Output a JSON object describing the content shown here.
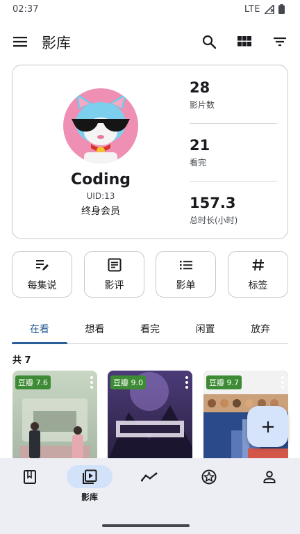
{
  "status_bar": {
    "time": "02:37",
    "network": "LTE"
  },
  "app_bar": {
    "title": "影库",
    "icons": [
      "menu-icon",
      "search-icon",
      "grid-view-icon",
      "filter-icon"
    ]
  },
  "profile": {
    "nickname": "Coding",
    "uid": "UID:13",
    "membership": "终身会员",
    "stats": [
      {
        "value": "28",
        "label": "影片数"
      },
      {
        "value": "21",
        "label": "看完"
      },
      {
        "value": "157.3",
        "label": "总时长(小时)"
      }
    ]
  },
  "quick_actions": [
    {
      "label": "每集说",
      "icon": "edit-note-icon"
    },
    {
      "label": "影评",
      "icon": "article-icon"
    },
    {
      "label": "影单",
      "icon": "list-icon"
    },
    {
      "label": "标签",
      "icon": "tag-icon"
    }
  ],
  "tabs": [
    {
      "label": "在看",
      "active": true
    },
    {
      "label": "想看"
    },
    {
      "label": "看完"
    },
    {
      "label": "闲置"
    },
    {
      "label": "放弃"
    }
  ],
  "total_count": "共 7",
  "posters": [
    {
      "rating": "豆瓣 7.6"
    },
    {
      "rating": "豆瓣 9.0"
    },
    {
      "rating": "豆瓣 9.7"
    }
  ],
  "bottom_nav": [
    {
      "label": "",
      "icon": "book-icon"
    },
    {
      "label": "影库",
      "icon": "video-library-icon",
      "active": true
    },
    {
      "label": "",
      "icon": "trend-icon"
    },
    {
      "label": "",
      "icon": "star-badge-icon"
    },
    {
      "label": "",
      "icon": "person-icon"
    }
  ],
  "colors": {
    "accent": "#2b5d96",
    "rating_bg": "#3d8b35",
    "nav_bg": "#eceef4",
    "fab_bg": "#d6e4fb"
  }
}
